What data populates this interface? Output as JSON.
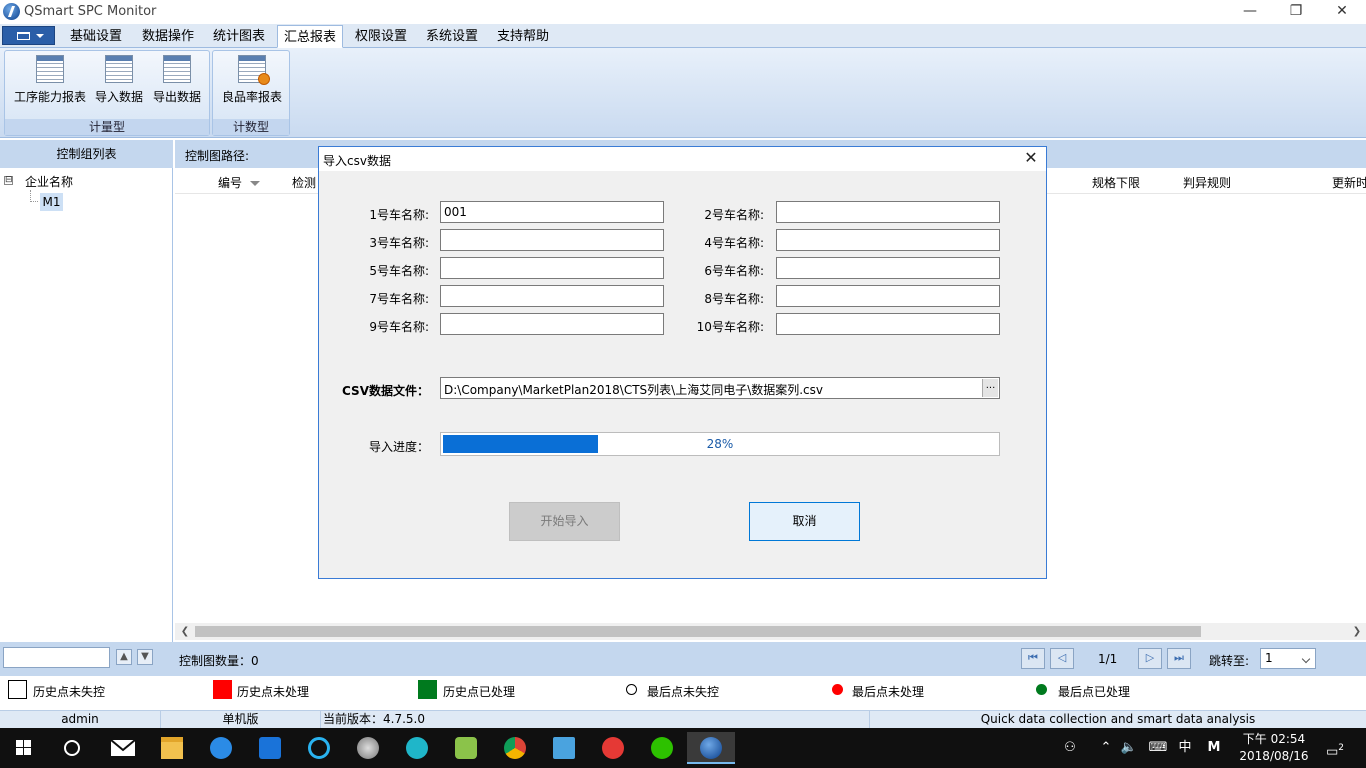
{
  "window": {
    "title": "QSmart SPC Monitor",
    "minimize": "—",
    "restore": "❐",
    "close": "✕"
  },
  "menu": {
    "tabs": [
      {
        "label": "基础设置"
      },
      {
        "label": "数据操作"
      },
      {
        "label": "统计图表"
      },
      {
        "label": "汇总报表",
        "active": true
      },
      {
        "label": "权限设置"
      },
      {
        "label": "系统设置"
      },
      {
        "label": "支持帮助"
      }
    ]
  },
  "ribbon": {
    "groups": [
      {
        "label": "计量型",
        "buttons": [
          {
            "label": "工序能力报表",
            "icon": "report-table-icon"
          },
          {
            "label": "导入数据",
            "icon": "import-table-icon"
          },
          {
            "label": "导出数据",
            "icon": "export-table-icon"
          }
        ]
      },
      {
        "label": "计数型",
        "buttons": [
          {
            "label": "良品率报表",
            "icon": "yield-report-icon"
          }
        ]
      }
    ]
  },
  "left_panel": {
    "header": "控制组列表",
    "tree": {
      "toggle": "⊟",
      "root": "企业名称",
      "children": [
        {
          "label": "M1"
        }
      ]
    }
  },
  "main": {
    "path_label": "控制图路径:",
    "columns": [
      {
        "label": "编号"
      },
      {
        "label": "检测"
      },
      {
        "label": "规格下限"
      },
      {
        "label": "判异规则"
      },
      {
        "label": "更新时"
      }
    ]
  },
  "bottom_toolbar": {
    "search_value": "",
    "up_glyph": "▲",
    "down_glyph": "▼",
    "count_label": "控制图数量：0",
    "page_indicator": "1/1",
    "nav": {
      "first": "⏮",
      "prev": "◁",
      "next": "▷",
      "last": "⏭"
    },
    "jump_label": "跳转至:",
    "jump_value": "1"
  },
  "legend": {
    "items": [
      {
        "label": "历史点未失控",
        "shape": "square",
        "color": "#ffffff",
        "border": "#000000"
      },
      {
        "label": "历史点未处理",
        "shape": "square",
        "color": "#ff0000"
      },
      {
        "label": "历史点已处理",
        "shape": "square",
        "color": "#007a1e"
      },
      {
        "label": "最后点未失控",
        "shape": "circle",
        "color": "#ffffff",
        "border": "#000000"
      },
      {
        "label": "最后点未处理",
        "shape": "circle",
        "color": "#ff0000"
      },
      {
        "label": "最后点已处理",
        "shape": "circle",
        "color": "#007a1e"
      }
    ]
  },
  "statusbar": {
    "user": "admin",
    "mode": "单机版",
    "version": "当前版本：4.7.5.0",
    "slogan": "Quick data collection and smart data analysis"
  },
  "dialog": {
    "title": "导入csv数据",
    "close_glyph": "✕",
    "fields": [
      {
        "label": "1号车名称:",
        "value": "001"
      },
      {
        "label": "2号车名称:",
        "value": ""
      },
      {
        "label": "3号车名称:",
        "value": ""
      },
      {
        "label": "4号车名称:",
        "value": ""
      },
      {
        "label": "5号车名称:",
        "value": ""
      },
      {
        "label": "6号车名称:",
        "value": ""
      },
      {
        "label": "7号车名称:",
        "value": ""
      },
      {
        "label": "8号车名称:",
        "value": ""
      },
      {
        "label": "9号车名称:",
        "value": ""
      },
      {
        "label": "10号车名称:",
        "value": ""
      }
    ],
    "csv_label": "CSV数据文件：",
    "csv_path": "D:\\Company\\MarketPlan2018\\CTS列表\\上海艾同电子\\数据案列.csv",
    "browse_glyph": "...",
    "progress_label": "导入进度：",
    "progress_text": "28%",
    "progress_value": 0.28,
    "start_button": "开始导入",
    "cancel_button": "取消"
  },
  "taskbar": {
    "apps": [
      {
        "icon": "search-circle-icon"
      },
      {
        "icon": "mail-icon"
      },
      {
        "icon": "file-explorer-icon"
      },
      {
        "icon": "sogou-browser-icon"
      },
      {
        "icon": "cp-app-icon"
      },
      {
        "icon": "qq-browser-icon"
      },
      {
        "icon": "globe-app-icon"
      },
      {
        "icon": "film-app-icon"
      },
      {
        "icon": "green-app-icon"
      },
      {
        "icon": "chrome-icon"
      },
      {
        "icon": "notes-app-icon"
      },
      {
        "icon": "red-app-icon"
      },
      {
        "icon": "wechat-icon"
      },
      {
        "icon": "qsmart-icon",
        "active": true
      }
    ],
    "tray": {
      "ime_lang": "中",
      "ime_mode": "M",
      "time": "下午 02:54",
      "date": "2018/08/16",
      "notification_count": "2"
    }
  }
}
